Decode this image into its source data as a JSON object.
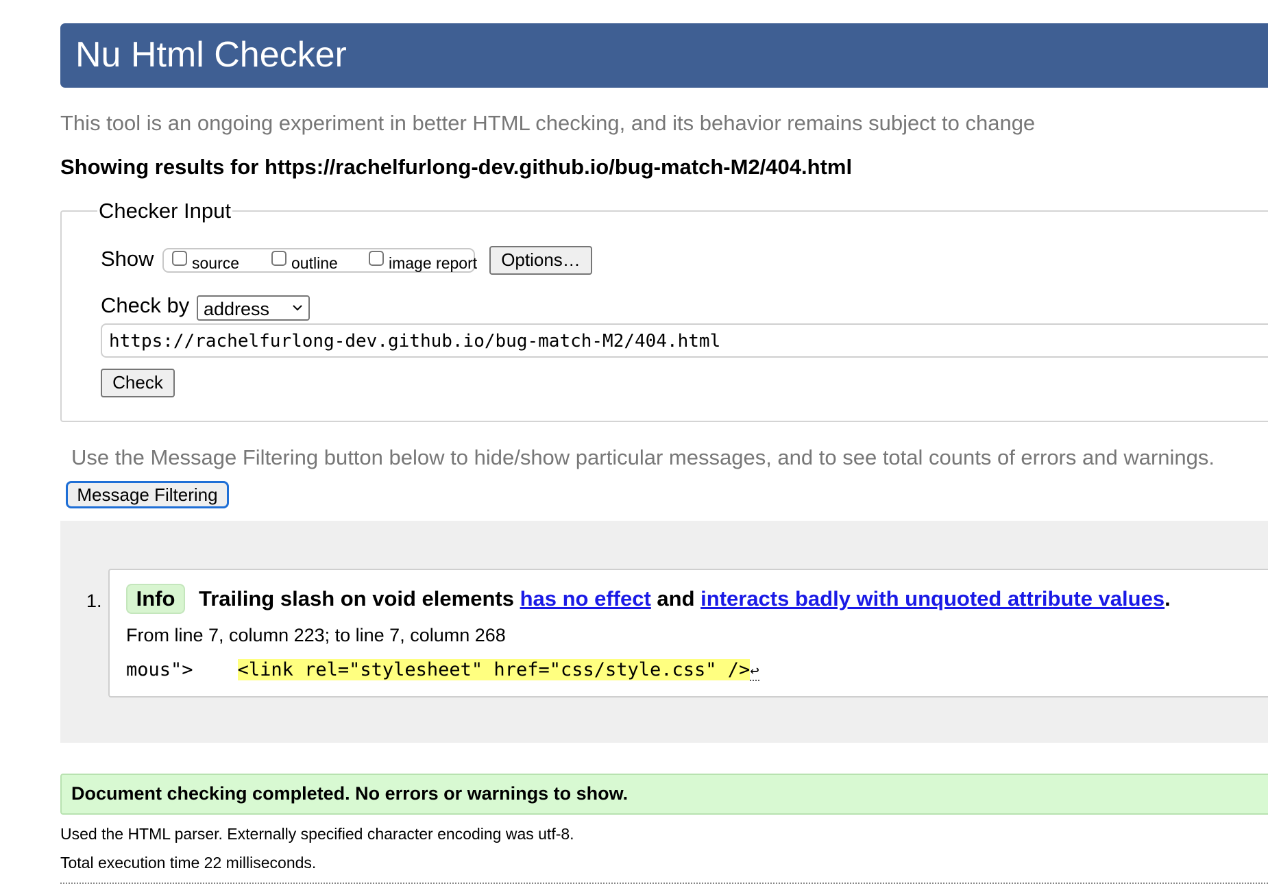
{
  "header": {
    "title": "Nu Html Checker"
  },
  "tagline": "This tool is an ongoing experiment in better HTML checking, and its behavior remains subject to change",
  "showing_results": "Showing results for https://rachelfurlong-dev.github.io/bug-match-M2/404.html",
  "checker_input": {
    "legend": "Checker Input",
    "show_label": "Show",
    "show_options": [
      {
        "label": "source",
        "checked": false
      },
      {
        "label": "outline",
        "checked": false
      },
      {
        "label": "image report",
        "checked": false
      }
    ],
    "options_button": "Options…",
    "check_by_label": "Check by",
    "check_by_value": "address",
    "url_value": "https://rachelfurlong-dev.github.io/bug-match-M2/404.html",
    "check_button": "Check"
  },
  "filter_note": "Use the Message Filtering button below to hide/show particular messages, and to see total counts of errors and warnings.",
  "filter_button": "Message Filtering",
  "messages": [
    {
      "number": "1.",
      "type": "Info",
      "text_before": "Trailing slash on void elements ",
      "link1": "has no effect",
      "text_middle": " and ",
      "link2": "interacts badly with unquoted attribute values",
      "text_after": ".",
      "location": "From line 7, column 223; to line 7, column 268",
      "extract_before": "mous\">    ",
      "extract_highlight": "<link rel=\"stylesheet\" href=\"css/style.css\" />",
      "extract_after": "↩"
    }
  ],
  "completed": "Document checking completed. No errors or warnings to show.",
  "details": {
    "parser": "Used the HTML parser. Externally specified character encoding was utf-8.",
    "time": "Total execution time 22 milliseconds."
  },
  "colors": {
    "header_bg": "#3f5f93",
    "info_badge": "#d8f5d0",
    "success_bg": "#d8f9d2",
    "link": "#1a1ae6",
    "highlight": "#ffff80"
  }
}
